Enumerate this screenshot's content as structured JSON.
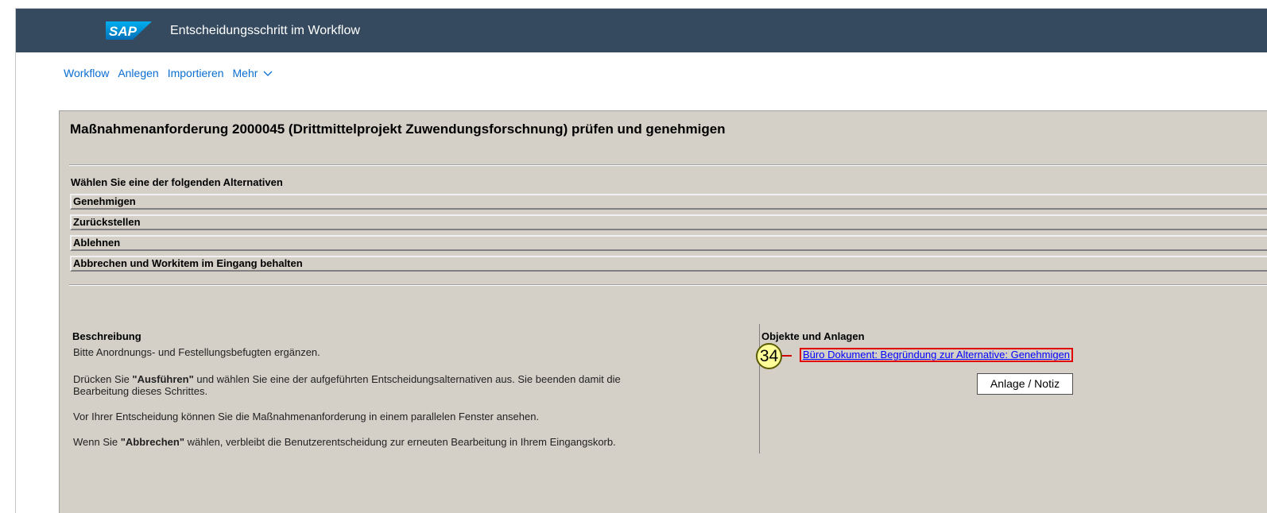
{
  "shell": {
    "logo_text": "SAP",
    "title": "Entscheidungsschritt im Workflow"
  },
  "menu": {
    "items": [
      "Workflow",
      "Anlegen",
      "Importieren",
      "Mehr"
    ]
  },
  "panel": {
    "title": "Maßnahmenanforderung 2000045 (Drittmittelprojekt Zuwendungsforschnung) prüfen und genehmigen",
    "alternatives_heading": "Wählen Sie eine der folgenden Alternativen",
    "alternatives": [
      "Genehmigen",
      "Zurückstellen",
      "Ablehnen",
      "Abbrechen und Workitem im Eingang behalten"
    ]
  },
  "description": {
    "title": "Beschreibung",
    "line1": "Bitte Anordnungs- und Festellungsbefugten ergänzen.",
    "line2_pre": "Drücken Sie ",
    "line2_bold": "\"Ausführen\"",
    "line2_post": " und wählen Sie eine der aufgeführten Entscheidungsalternativen aus. Sie beenden damit die",
    "line2_cont": "Bearbeitung dieses Schrittes.",
    "line3": "Vor Ihrer Entscheidung können Sie die Maßnahmenanforderung in einem parallelen Fenster ansehen.",
    "line4_pre": "Wenn Sie ",
    "line4_bold": "\"Abbrechen\"",
    "line4_post": " wählen, verbleibt die Benutzerentscheidung zur erneuten Bearbeitung in Ihrem Eingangskorb."
  },
  "objects": {
    "title": "Objekte und Anlagen",
    "callout_number": "34",
    "link": "Büro Dokument: Begründung zur Alternative: Genehmigen",
    "button": "Anlage / Notiz"
  },
  "colors": {
    "shellbar": "#354a5f",
    "panel": "#d4d0c8",
    "link": "#0a6ed1",
    "highlight": "#e00000",
    "callout": "#ffff99"
  }
}
